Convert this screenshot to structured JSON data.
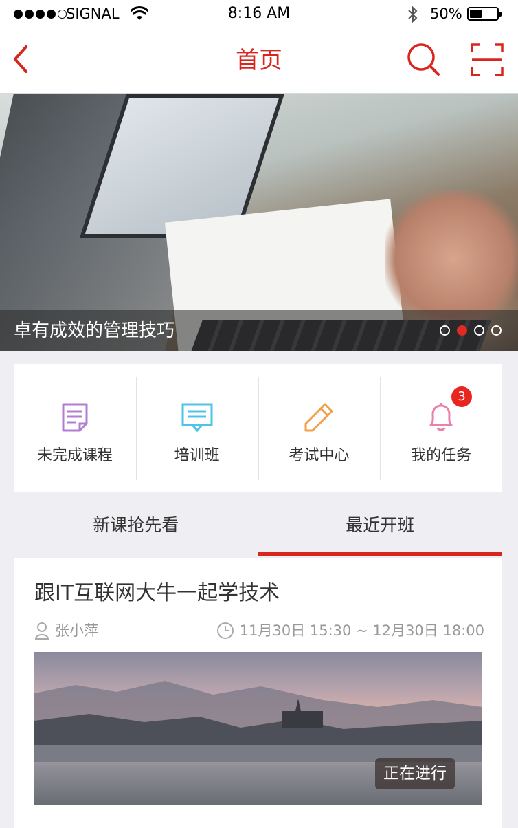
{
  "status_bar": {
    "carrier": "SIGNAL",
    "time": "8:16 AM",
    "battery_percent": "50%",
    "battery_level": 0.5,
    "signal_bars_filled": 4,
    "signal_bars_total": 5
  },
  "nav": {
    "title": "首页",
    "back_icon": "chevron-left-icon",
    "search_icon": "search-icon",
    "scan_icon": "scan-icon",
    "accent_color": "#d8261f"
  },
  "banner": {
    "caption": "卓有成效的管理技巧",
    "page_count": 4,
    "active_index": 1
  },
  "quick_menu": [
    {
      "label": "未完成课程",
      "icon": "document-icon",
      "color": "#b07fd3"
    },
    {
      "label": "培训班",
      "icon": "presentation-icon",
      "color": "#4fc3e8"
    },
    {
      "label": "考试中心",
      "icon": "pencil-icon",
      "color": "#f0a04b"
    },
    {
      "label": "我的任务",
      "icon": "bell-icon",
      "color": "#e980ad",
      "badge": "3"
    }
  ],
  "tabs": [
    {
      "label": "新课抢先看",
      "active": false
    },
    {
      "label": "最近开班",
      "active": true
    }
  ],
  "course": {
    "title": "跟IT互联网大牛一起学技术",
    "author": "张小萍",
    "time_range": "11月30日 15:30 ~ 12月30日 18:00",
    "status": "正在进行"
  }
}
